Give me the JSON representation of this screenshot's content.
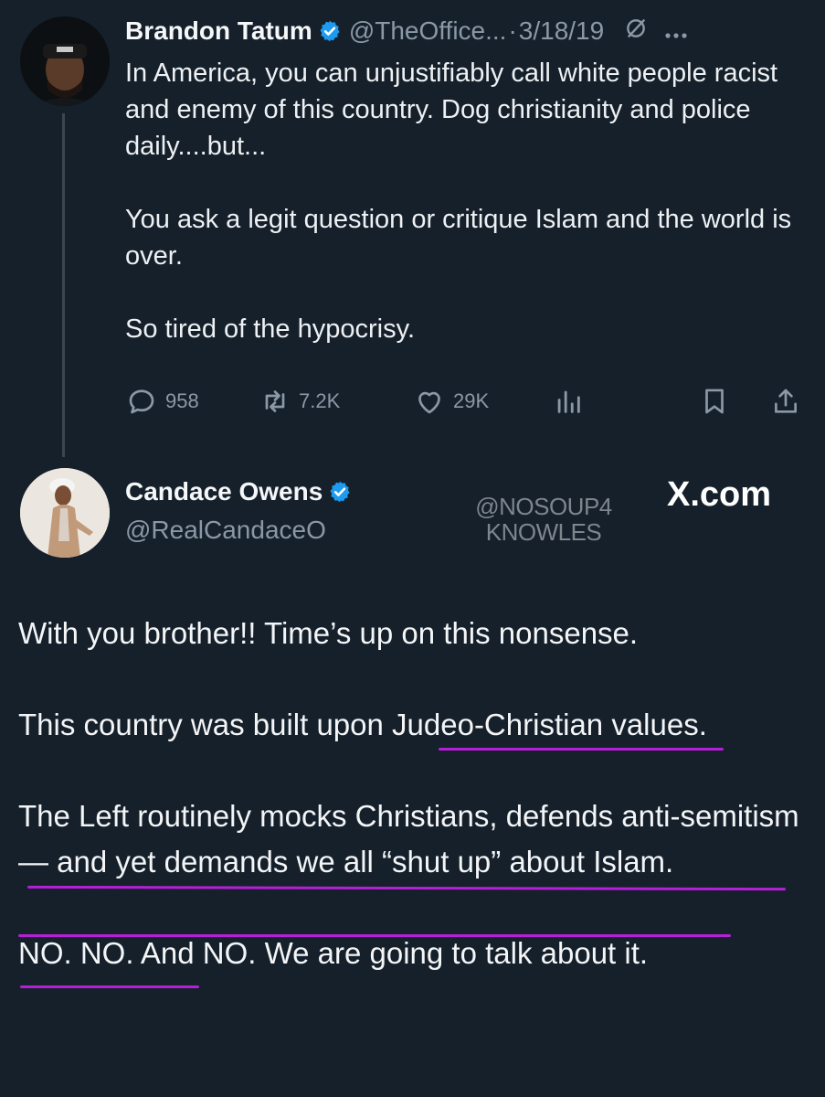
{
  "tweet1": {
    "author_name": "Brandon Tatum",
    "handle": "@TheOffice...",
    "separator": "·",
    "date": "3/18/19",
    "paragraphs": [
      "In America, you can unjustifiably call white people racist and enemy of this country. Dog christianity and police daily....but...",
      "You ask a legit question or critique Islam and the world is over.",
      "So tired of the hypocrisy."
    ],
    "actions": {
      "replies": "958",
      "reposts": "7.2K",
      "likes": "29K"
    },
    "icons": [
      "grok-icon",
      "more-icon",
      "reply-icon",
      "repost-icon",
      "like-icon",
      "views-icon",
      "bookmark-icon",
      "share-icon"
    ]
  },
  "tweet2": {
    "author_name": "Candace Owens",
    "handle": "@RealCandaceO",
    "paragraphs": [
      "With you brother!! Time’s up on this nonsense.",
      "This country was built upon Judeo-Christian values.",
      "The Left routinely mocks Christians, defends anti-semitism— and yet demands we all “shut up” about Islam.",
      "NO. NO. And NO. We are going to talk about it."
    ]
  },
  "watermark": {
    "line1": "@NOSOUP4",
    "line2": "KNOWLES"
  },
  "source_label": "X.com",
  "colors": {
    "background": "#15202b",
    "verified": "#1d9bf0",
    "muted": "#8b98a5",
    "underline": "#b61fd8"
  }
}
